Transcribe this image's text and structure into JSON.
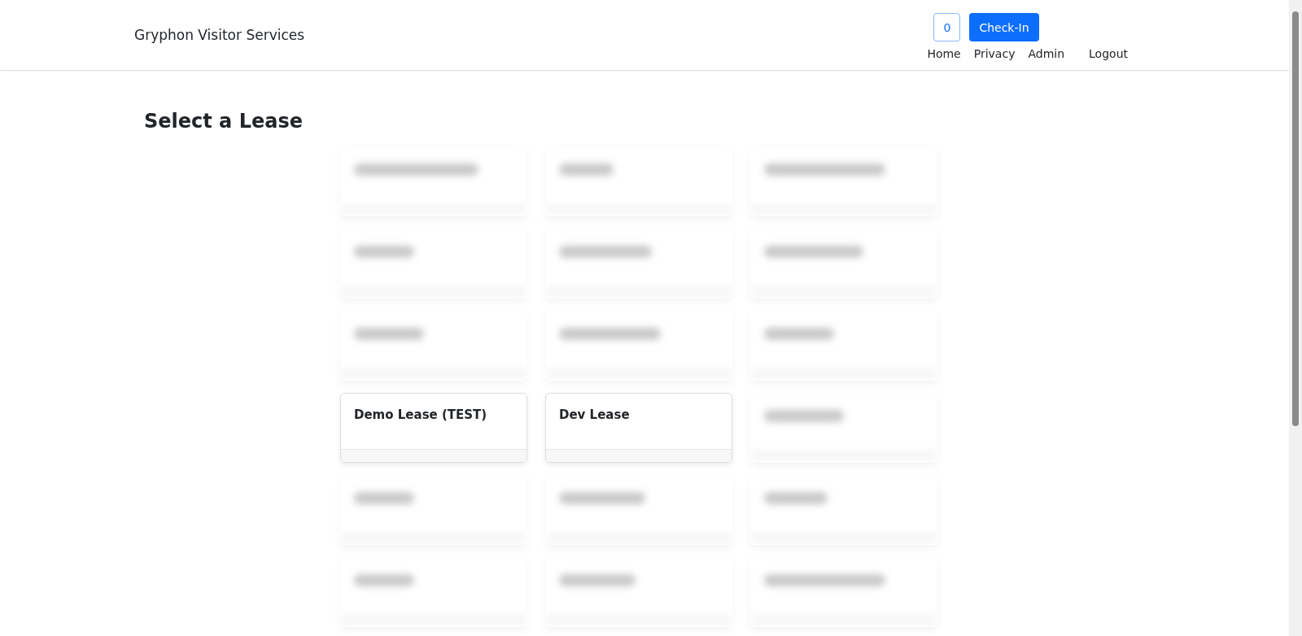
{
  "header": {
    "brand": "Gryphon Visitor Services",
    "counter": "0",
    "check_in": "Check-In",
    "nav": [
      "Home",
      "Privacy",
      "Admin",
      "Logout"
    ]
  },
  "heading": "Select a Lease",
  "leases": [
    {
      "kind": "redacted"
    },
    {
      "kind": "redacted"
    },
    {
      "kind": "redacted"
    },
    {
      "kind": "redacted"
    },
    {
      "kind": "redacted"
    },
    {
      "kind": "redacted"
    },
    {
      "kind": "redacted"
    },
    {
      "kind": "redacted"
    },
    {
      "kind": "redacted"
    },
    {
      "kind": "lease",
      "name": "Demo Lease (TEST)"
    },
    {
      "kind": "lease",
      "name": "Dev Lease"
    },
    {
      "kind": "redacted"
    },
    {
      "kind": "redacted"
    },
    {
      "kind": "redacted"
    },
    {
      "kind": "redacted"
    },
    {
      "kind": "redacted"
    },
    {
      "kind": "redacted"
    },
    {
      "kind": "redacted"
    }
  ]
}
